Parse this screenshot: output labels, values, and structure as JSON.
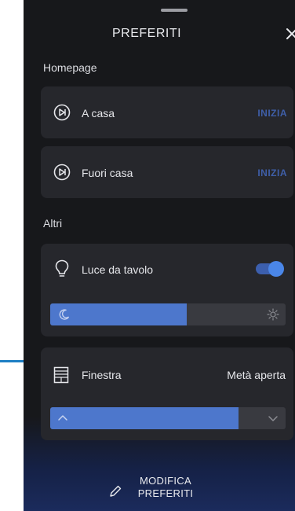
{
  "sheet": {
    "title": "PREFERITI",
    "close_icon": "close-icon"
  },
  "homepage": {
    "section_label": "Homepage",
    "items": [
      {
        "label": "A casa",
        "action": "INIZIA",
        "icon": "play-circle-icon"
      },
      {
        "label": "Fuori casa",
        "action": "INIZIA",
        "icon": "play-circle-icon"
      }
    ]
  },
  "others": {
    "section_label": "Altri",
    "lamp": {
      "label": "Luce da tavolo",
      "icon": "lightbulb-icon",
      "toggle_on": true,
      "brightness_fraction": 0.58
    },
    "window": {
      "label": "Finestra",
      "value": "Metà aperta",
      "icon": "window-icon",
      "position_fraction": 0.8
    }
  },
  "footer": {
    "edit_label_line1": "MODIFICA",
    "edit_label_line2": "PREFERITI",
    "icon": "pencil-icon"
  },
  "colors": {
    "background": "#17181b",
    "card": "#26272c",
    "accent": "#4d77cc",
    "action_text": "#3f5fa9",
    "connector": "#1e7fc4"
  }
}
